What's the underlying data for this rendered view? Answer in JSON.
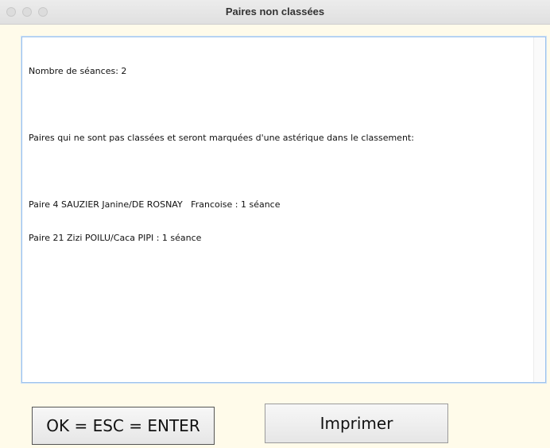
{
  "window": {
    "title": "Paires non classées"
  },
  "report": {
    "sessions_line": "Nombre de séances: 2",
    "intro_line": "Paires qui ne sont pas classées et seront marquées d'une astérique dans le classement:",
    "pairs": [
      "Paire 4 SAUZIER Janine/DE ROSNAY   Francoise : 1 séance",
      "Paire 21 Zizi POILU/Caca PIPI : 1 séance"
    ]
  },
  "buttons": {
    "ok_label": "OK = ESC = ENTER",
    "print_label": "Imprimer"
  }
}
